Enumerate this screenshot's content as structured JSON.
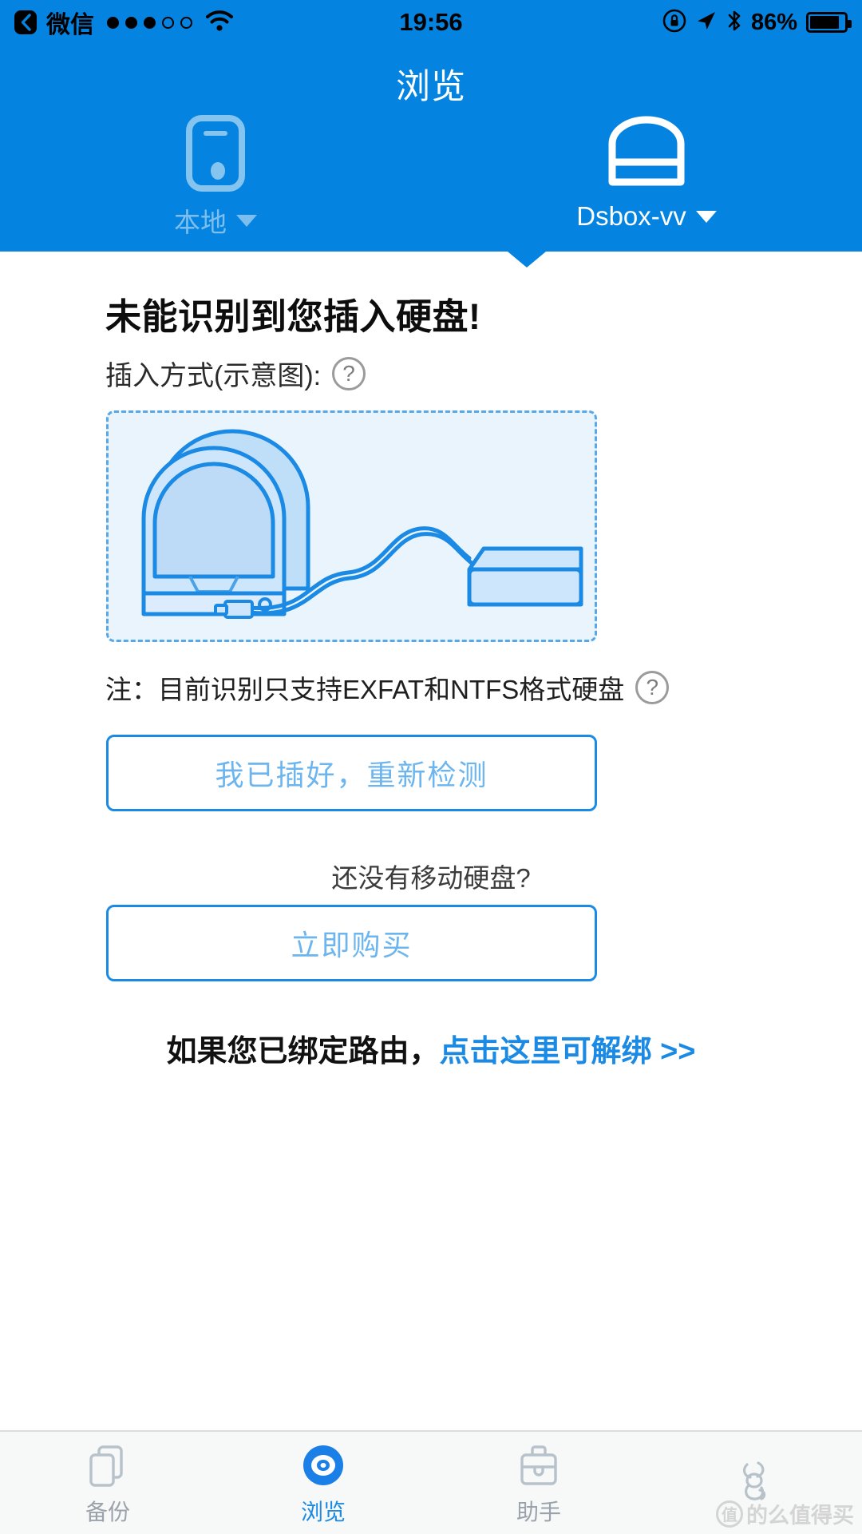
{
  "status_bar": {
    "back_icon": "back-arrow-icon",
    "carrier": "微信",
    "signal_dots_filled": 3,
    "signal_dots_total": 5,
    "wifi_icon": "wifi-icon",
    "time": "19:56",
    "rotation_lock_icon": "rotation-lock-icon",
    "location_icon": "location-arrow-icon",
    "bluetooth_icon": "bluetooth-icon",
    "battery_percent": "86%",
    "battery_level": 86
  },
  "header": {
    "title": "浏览",
    "tabs": [
      {
        "label": "本地",
        "icon": "phone-device-icon",
        "active": false,
        "caret": "▼"
      },
      {
        "label": "Dsbox-vv",
        "icon": "dock-device-icon",
        "active": true,
        "caret": "▼"
      }
    ]
  },
  "main": {
    "heading": "未能识别到您插入硬盘!",
    "subtitle": "插入方式(示意图):",
    "subtitle_help_icon": "question-mark-circle-icon",
    "illustration": "dock-and-external-drive-diagram",
    "note": "注：目前识别只支持EXFAT和NTFS格式硬盘",
    "note_help_icon": "question-mark-circle-icon",
    "detect_button": "我已插好，重新检测",
    "no_disk_text": "还没有移动硬盘?",
    "buy_button": "立即购买",
    "unbind_prefix": "如果您已绑定路由，",
    "unbind_link": "点击这里可解绑 >>"
  },
  "tabbar": {
    "items": [
      {
        "label": "备份",
        "icon": "two-phones-backup-icon",
        "active": false
      },
      {
        "label": "浏览",
        "icon": "eye-browse-icon",
        "active": true
      },
      {
        "label": "助手",
        "icon": "briefcase-assistant-icon",
        "active": false
      },
      {
        "label": "",
        "icon": "rabbit-mascot-icon",
        "active": false
      }
    ]
  },
  "watermark": {
    "text": "的么值得买",
    "badge": "值"
  },
  "colors": {
    "brand_blue": "#0484e0",
    "accent_blue": "#1b8ae5",
    "illus_fill": "#e9f4fd",
    "tabbar_bg": "#f7f8f8",
    "inactive_gray": "#9aa3ab"
  }
}
